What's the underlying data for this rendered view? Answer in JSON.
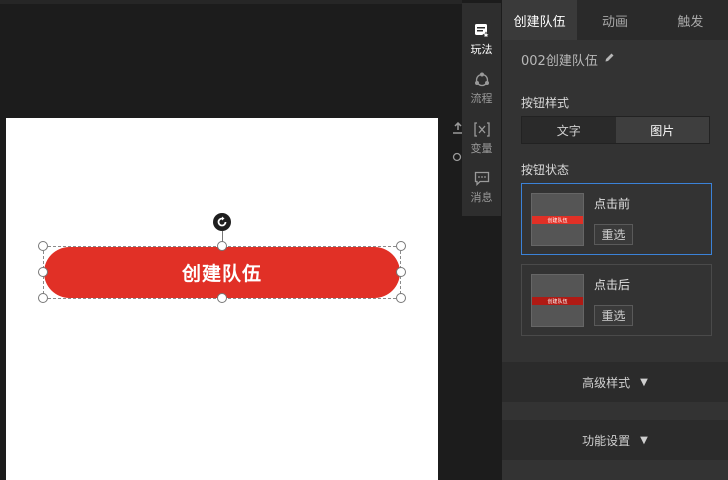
{
  "canvas": {
    "button_text": "创建队伍"
  },
  "side_tools": {
    "upload_icon": "upload-icon",
    "search_icon": "search-icon"
  },
  "vertical_toolbar": {
    "items": [
      {
        "label": "玩法",
        "icon": "gameplay-icon",
        "active": true
      },
      {
        "label": "流程",
        "icon": "flow-icon",
        "active": false
      },
      {
        "label": "变量",
        "icon": "variable-icon",
        "active": false
      },
      {
        "label": "消息",
        "icon": "message-icon",
        "active": false
      }
    ]
  },
  "panel": {
    "tabs": [
      {
        "label": "创建队伍",
        "active": true
      },
      {
        "label": "动画",
        "active": false
      },
      {
        "label": "触发",
        "active": false
      }
    ],
    "component_name": "002创建队伍",
    "button_style_label": "按钮样式",
    "style_options": [
      {
        "label": "文字",
        "active": false
      },
      {
        "label": "图片",
        "active": true
      }
    ],
    "button_state_label": "按钮状态",
    "states": [
      {
        "title": "点击前",
        "reselect": "重选",
        "thumb_color": "#e13026"
      },
      {
        "title": "点击后",
        "reselect": "重选",
        "thumb_color": "#b01a14"
      }
    ],
    "advanced_style": "高级样式",
    "function_settings": "功能设置"
  },
  "colors": {
    "accent_red": "#e13026",
    "selected_border": "#3b82d8"
  }
}
